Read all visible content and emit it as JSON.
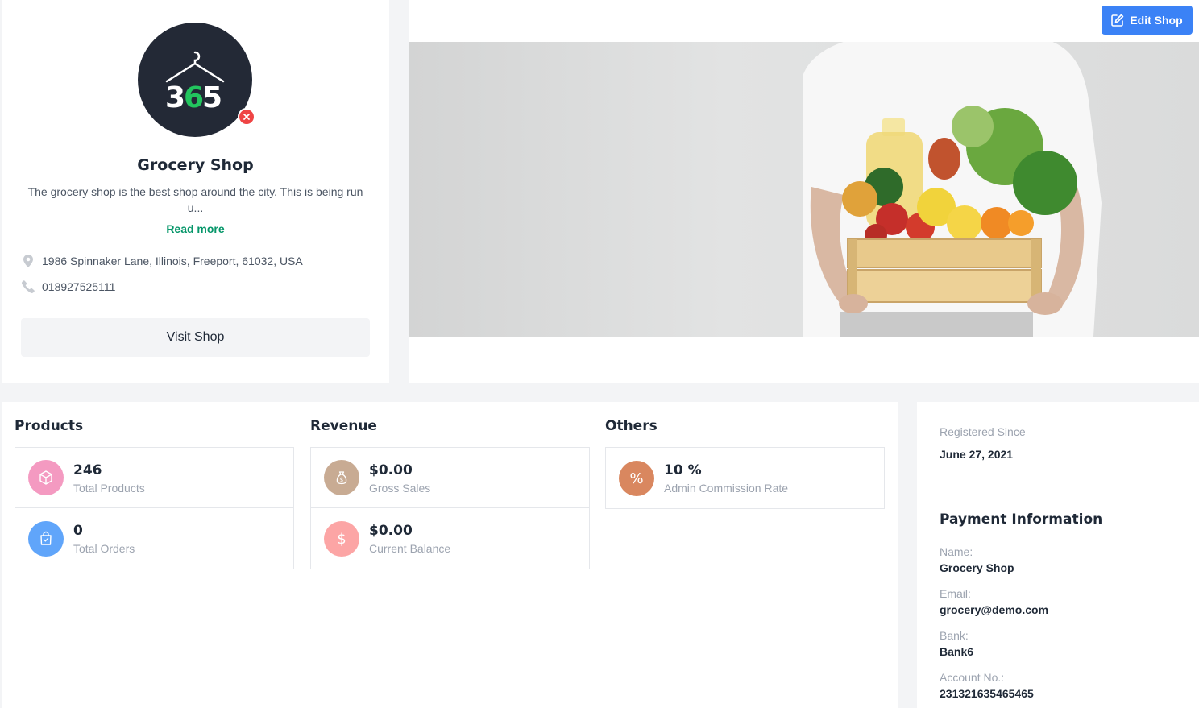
{
  "shop": {
    "logo_text": "365",
    "name": "Grocery Shop",
    "description": "The grocery shop is the best shop around the city. This is being run u...",
    "read_more": "Read more",
    "address": "1986 Spinnaker Lane, Illinois, Freeport, 61032, USA",
    "phone": "018927525111",
    "visit_label": "Visit Shop"
  },
  "banner": {
    "edit_label": "Edit Shop"
  },
  "stats": {
    "products": {
      "title": "Products",
      "items": [
        {
          "value": "246",
          "label": "Total Products",
          "icon": "cube-icon",
          "color": "#f49ac1"
        },
        {
          "value": "0",
          "label": "Total Orders",
          "icon": "shopping-bag-icon",
          "color": "#60a5fa"
        }
      ]
    },
    "revenue": {
      "title": "Revenue",
      "items": [
        {
          "value": "$0.00",
          "label": "Gross Sales",
          "icon": "money-bag-icon",
          "color": "#c8ab93"
        },
        {
          "value": "$0.00",
          "label": "Current Balance",
          "icon": "dollar-icon",
          "color": "#fca5a5"
        }
      ]
    },
    "others": {
      "title": "Others",
      "items": [
        {
          "value": "10 %",
          "label": "Admin Commission Rate",
          "icon": "percent-icon",
          "color": "#d9875f"
        }
      ]
    }
  },
  "side": {
    "registered_label": "Registered Since",
    "registered_value": "June 27, 2021",
    "payment_title": "Payment Information",
    "name_label": "Name:",
    "name_value": "Grocery Shop",
    "email_label": "Email:",
    "email_value": "grocery@demo.com",
    "bank_label": "Bank:",
    "bank_value": "Bank6",
    "account_label": "Account No.:",
    "account_value": "231321635465465"
  },
  "colors": {
    "accent_green": "#059669",
    "accent_blue": "#3b82f6",
    "danger": "#ef4444"
  }
}
